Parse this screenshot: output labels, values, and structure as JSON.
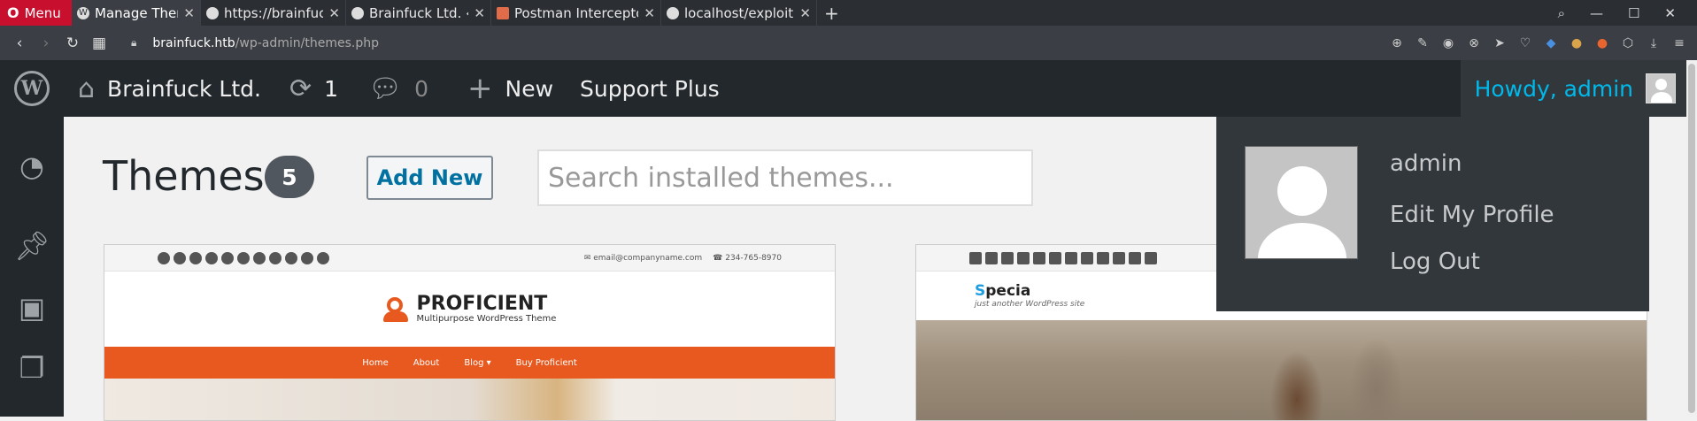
{
  "browser": {
    "menu_label": "Menu",
    "tabs": [
      {
        "title": "Manage Themes ‹ Bra",
        "active": true
      },
      {
        "title": "https://brainfuck.htb",
        "active": false
      },
      {
        "title": "Brainfuck Ltd. ‹ Log In",
        "active": false
      },
      {
        "title": "Postman Interceptor",
        "active": false
      },
      {
        "title": "localhost/exploit.htm",
        "active": false
      }
    ],
    "url_host": "brainfuck.htb",
    "url_path": "/wp-admin/themes.php"
  },
  "adminbar": {
    "site_name": "Brainfuck Ltd.",
    "updates_count": "1",
    "comments_count": "0",
    "new_label": "New",
    "support_label": "Support Plus",
    "howdy_label": "Howdy, admin"
  },
  "user_menu": {
    "username": "admin",
    "edit_profile": "Edit My Profile",
    "logout": "Log Out"
  },
  "page": {
    "title": "Themes",
    "theme_count": "5",
    "add_new_label": "Add New",
    "search_placeholder": "Search installed themes..."
  },
  "themes": [
    {
      "email": "email@companyname.com",
      "phone": "234-765-8970",
      "name": "PROFICIENT",
      "tagline": "Multipurpose WordPress Theme",
      "menu": [
        "Home",
        "About",
        "Blog ▾",
        "Buy Proficient"
      ]
    },
    {
      "name_first": "S",
      "name_rest": "pecia",
      "tagline": "just another WordPress site"
    }
  ],
  "colors": {
    "adminbar": "#23282d",
    "accent_link": "#00b9eb",
    "proficient_orange": "#e8591f"
  }
}
